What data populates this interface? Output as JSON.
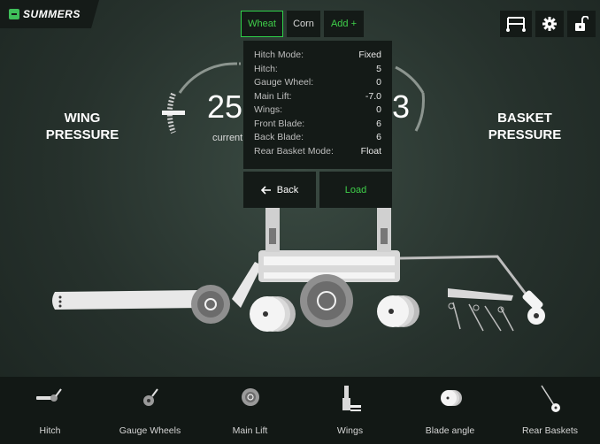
{
  "brand": {
    "name": "SUMMERS",
    "accent": "#3fd04a"
  },
  "tabs": [
    {
      "label": "Wheat",
      "active": true
    },
    {
      "label": "Corn",
      "active": false
    },
    {
      "label": "Add +",
      "active": false
    }
  ],
  "top_right_icons": [
    "machine-icon",
    "gear-icon",
    "unlock-icon"
  ],
  "wing": {
    "title_line1": "WING",
    "title_line2": "PRESSURE",
    "value": "25",
    "sub_label": "current"
  },
  "basket": {
    "title_line1": "BASKET",
    "title_line2": "PRESSURE",
    "value": "3"
  },
  "preset": {
    "rows": [
      {
        "key": "Hitch Mode:",
        "value": "Fixed"
      },
      {
        "key": "Hitch:",
        "value": "5"
      },
      {
        "key": "Gauge Wheel:",
        "value": "0"
      },
      {
        "key": "Main Lift:",
        "value": "-7.0"
      },
      {
        "key": "Wings:",
        "value": "0"
      },
      {
        "key": "Front Blade:",
        "value": "6"
      },
      {
        "key": "Back Blade:",
        "value": "6"
      },
      {
        "key": "Rear Basket Mode:",
        "value": "Float"
      }
    ],
    "back_label": "Back",
    "load_label": "Load"
  },
  "bottom_nav": [
    {
      "label": "Hitch",
      "icon": "hitch-icon"
    },
    {
      "label": "Gauge Wheels",
      "icon": "gauge-wheel-icon"
    },
    {
      "label": "Main Lift",
      "icon": "main-lift-icon"
    },
    {
      "label": "Wings",
      "icon": "wings-icon"
    },
    {
      "label": "Blade angle",
      "icon": "blade-icon"
    },
    {
      "label": "Rear Baskets",
      "icon": "basket-icon"
    }
  ]
}
